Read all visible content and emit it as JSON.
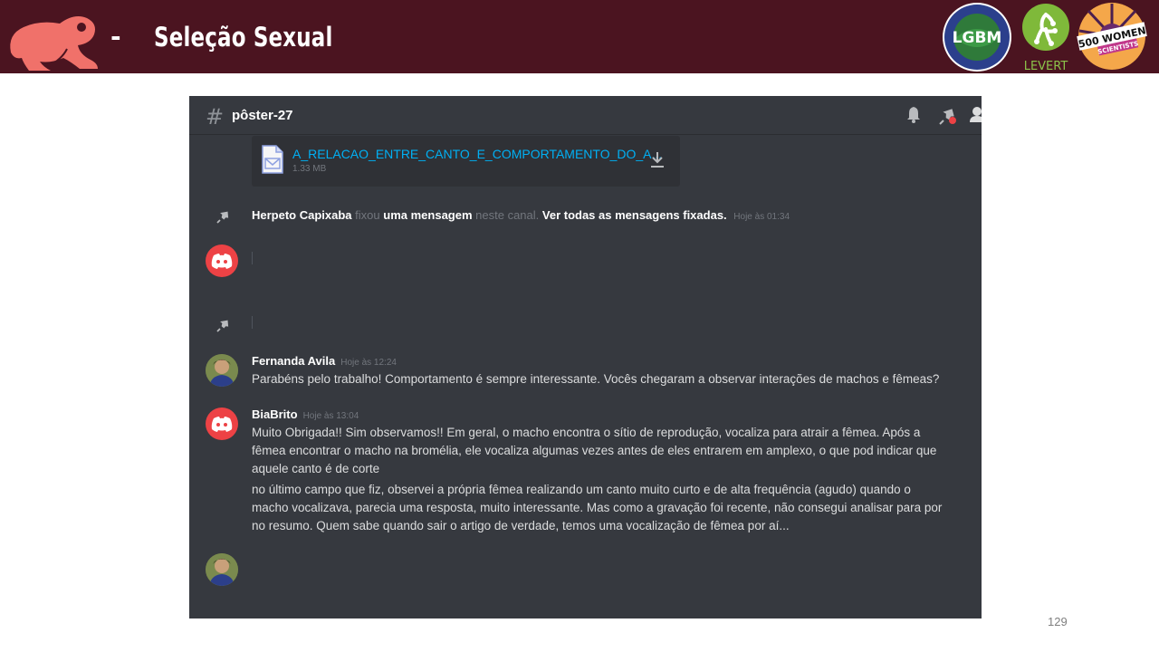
{
  "slide": {
    "dash": "-",
    "title": "Seleção Sexual",
    "page_number": "129"
  },
  "logos": {
    "lgbm": {
      "name": "LGBM",
      "ring_text": "EVOLUÇÃO, ECOLOGIA E GENÉTICA DA CONSERVAÇÃO"
    },
    "levert": {
      "name": "LEVERT"
    },
    "women": {
      "line1": "500 WOMEN",
      "line2": "SCIENTISTS"
    }
  },
  "discord": {
    "channel": "pôster-27",
    "attachment": {
      "filename": "A_RELACAO_ENTRE_CANTO_E_COMPORTAMENTO_DO_A...",
      "size": "1.33 MB"
    },
    "pin_notice": {
      "user": "Herpeto Capixaba",
      "verb": "fixou",
      "object": "uma mensagem",
      "rest": "neste canal.",
      "link": "Ver todas as mensagens fixadas.",
      "timestamp": "Hoje às 01:34"
    },
    "messages": [
      {
        "author": "Fernanda Avila",
        "timestamp": "Hoje às 12:24",
        "paragraphs": [
          "Parabéns pelo trabalho! Comportamento é sempre interessante. Vocês chegaram a observar interações de machos e fêmeas?"
        ]
      },
      {
        "author": "BiaBrito",
        "timestamp": "Hoje às 13:04",
        "paragraphs": [
          "Muito Obrigada!! Sim observamos!! Em geral, o macho encontra o sítio de reprodução, vocaliza para atrair a fêmea. Após a fêmea encontrar o macho na bromélia, ele vocaliza algumas vezes  antes de eles entrarem em amplexo, o que pod indicar que aquele canto é de corte",
          "no último campo que fiz, observei a própria fêmea realizando um canto muito curto e de alta frequência (agudo) quando o macho vocalizava, parecia uma resposta, muito interessante. Mas como a gravação foi recente, não consegui analisar para por no resumo. Quem sabe quando sair o artigo de verdade, temos uma vocalização de fêmea por aí..."
        ]
      }
    ]
  },
  "colors": {
    "banner": "#4b1420",
    "discord_bg": "#36393f",
    "discord_red": "#ed4245",
    "link_blue": "#00b0f4"
  }
}
